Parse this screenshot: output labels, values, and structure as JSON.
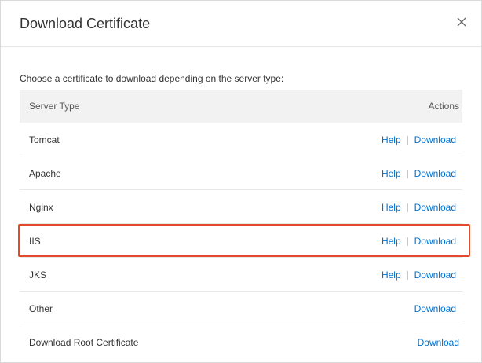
{
  "dialog": {
    "title": "Download Certificate",
    "close_icon": "close-icon",
    "instruction": "Choose a certificate to download depending on the server type:"
  },
  "table": {
    "headers": {
      "server_type": "Server Type",
      "actions": "Actions"
    },
    "rows": [
      {
        "name": "Tomcat",
        "help": "Help",
        "download": "Download"
      },
      {
        "name": "Apache",
        "help": "Help",
        "download": "Download"
      },
      {
        "name": "Nginx",
        "help": "Help",
        "download": "Download"
      },
      {
        "name": "IIS",
        "help": "Help",
        "download": "Download"
      },
      {
        "name": "JKS",
        "help": "Help",
        "download": "Download"
      },
      {
        "name": "Other",
        "download": "Download"
      },
      {
        "name": "Download Root Certificate",
        "download": "Download"
      }
    ]
  },
  "colors": {
    "link": "#0070cc",
    "highlight": "#e24a2b",
    "header_bg": "#f2f2f2"
  }
}
